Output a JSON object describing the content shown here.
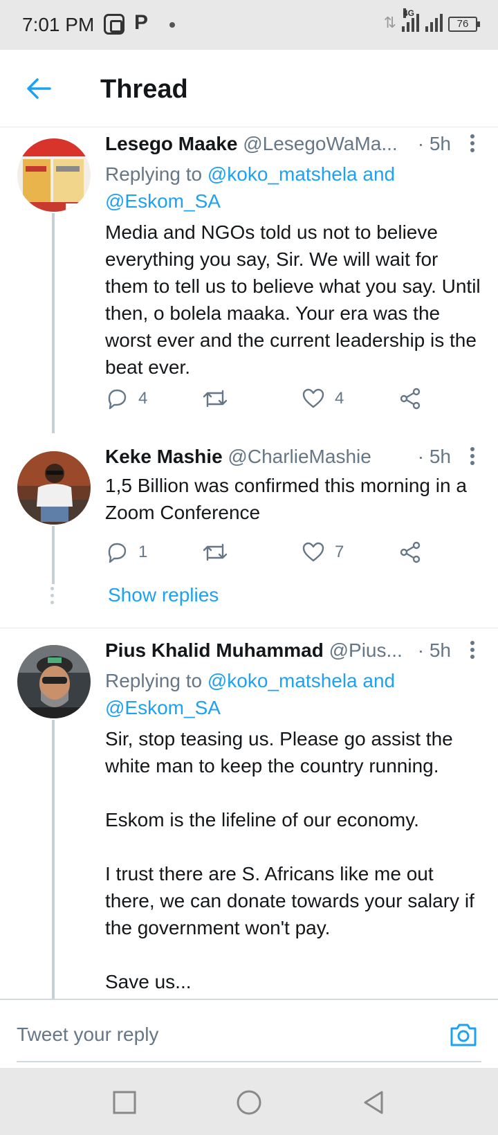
{
  "status_bar": {
    "time": "7:01 PM",
    "app_icon_p": "P",
    "network": "4G",
    "battery": "76"
  },
  "header": {
    "title": "Thread",
    "back_icon": "arrow-left-icon",
    "accent": "#1da1f2"
  },
  "tweets": [
    {
      "name": "Lesego Maake",
      "handle": "@LesegoWaMa...",
      "time": "· 5h",
      "replying_prefix": "Replying to ",
      "replying_to_1": "@koko_matshela and",
      "replying_to_2": "@Eskom_SA",
      "body": "Media and NGOs told us not to believe everything you say, Sir. We will wait for them to tell us to believe what you say. Until then, o bolela maaka. Your era was the worst ever and the current leadership is the beat ever.",
      "replies": "4",
      "retweets": "",
      "likes": "4"
    },
    {
      "name": "Keke Mashie",
      "handle": "@CharlieMashie",
      "time": "· 5h",
      "body": "1,5 Billion was confirmed this morning in a Zoom Conference",
      "replies": "1",
      "retweets": "",
      "likes": "7",
      "show_replies": "Show replies"
    },
    {
      "name": "Pius Khalid Muhammad",
      "handle": "@Pius...",
      "time": "· 5h",
      "replying_prefix": "Replying to ",
      "replying_to_1": "@koko_matshela and",
      "replying_to_2": "@Eskom_SA",
      "body": "Sir, stop teasing us. Please go assist the white man to keep the country running.\n\nEskom is the lifeline of our economy.\n\nI trust there are S. Africans like me out there, we can donate towards your salary if the government won't pay.\n\nSave us..."
    }
  ],
  "composer": {
    "placeholder": "Tweet your reply",
    "camera_icon": "camera-icon"
  },
  "nav": {
    "recent": "square-icon",
    "home": "circle-icon",
    "back": "triangle-back-icon"
  }
}
